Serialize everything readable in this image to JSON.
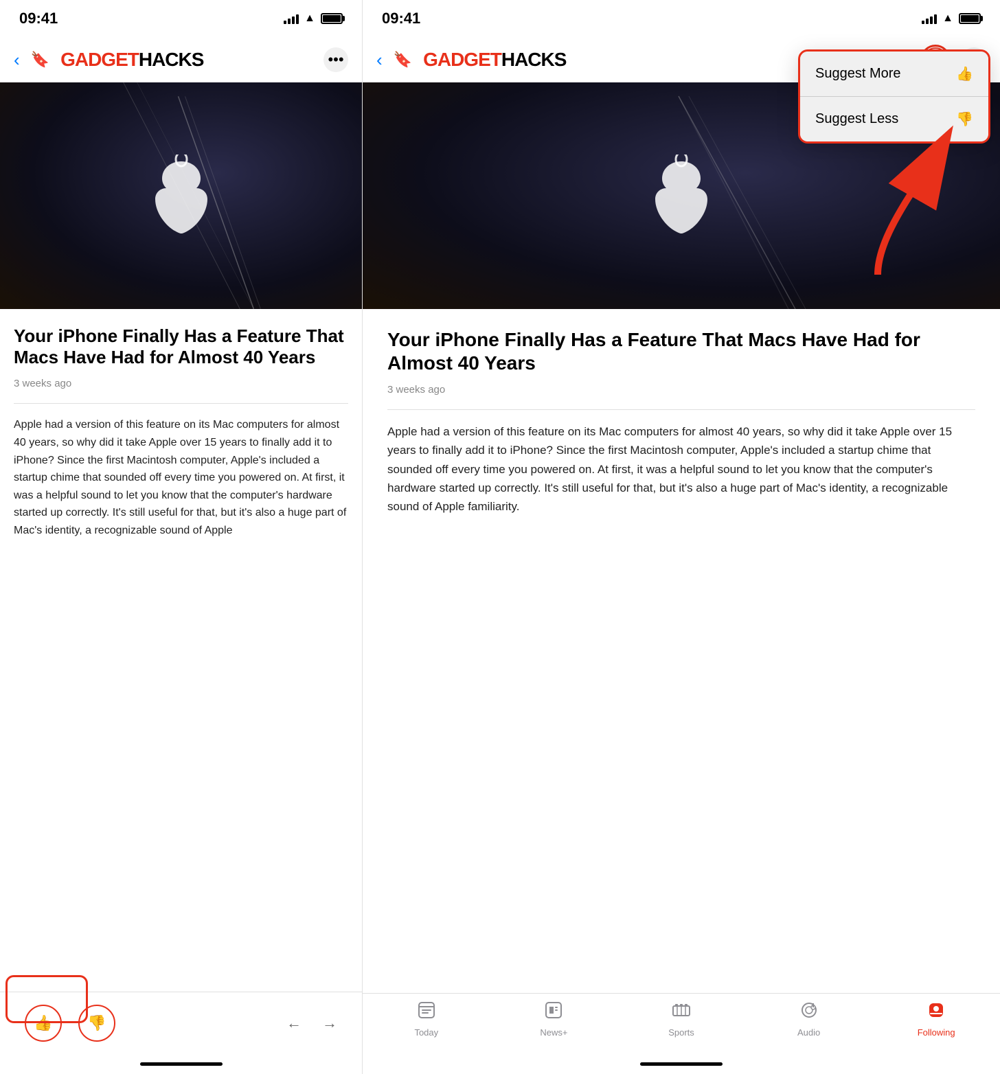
{
  "left_phone": {
    "status": {
      "time": "09:41"
    },
    "nav": {
      "back_label": "‹",
      "bookmark_label": "⊓",
      "logo_gadget": "GADGET",
      "logo_hacks": "HACKS",
      "more_label": "•••"
    },
    "article": {
      "title": "Your iPhone Finally Has a Feature That Macs Have Had for Almost 40 Years",
      "date": "3 weeks ago",
      "body": "Apple had a version of this feature on its Mac computers for almost 40 years, so why did it take Apple over 15 years to finally add it to iPhone? Since the first Macintosh computer, Apple's included a startup chime that sounded off every time you powered on. At first, it was a helpful sound to let you know that the computer's hardware started up correctly. It's still useful for that, but it's also a huge part of Mac's identity, a recognizable sound of Apple"
    },
    "bottom_bar": {
      "thumbup_label": "👍",
      "thumbdown_label": "👎",
      "back_arrow": "←",
      "forward_arrow": "→"
    }
  },
  "right_phone": {
    "status": {
      "time": "09:41"
    },
    "nav": {
      "back_label": "‹",
      "bookmark_label": "⊓",
      "logo_gadget": "GADGET",
      "logo_hacks": "HACKS",
      "thumb_label": "👍",
      "more_label": "•••"
    },
    "dropdown": {
      "suggest_more": "Suggest More",
      "suggest_more_icon": "👍",
      "suggest_less": "Suggest Less",
      "suggest_less_icon": "👎"
    },
    "article": {
      "title": "Your iPhone Finally Has a Feature That Macs Have Had for Almost 40 Years",
      "date": "3 weeks ago",
      "body": "Apple had a version of this feature on its Mac computers for almost 40 years, so why did it take Apple over 15 years to finally add it to iPhone? Since the first Macintosh computer, Apple's included a startup chime that sounded off every time you powered on. At first, it was a helpful sound to let you know that the computer's hardware started up correctly. It's still useful for that, but it's also a huge part of Mac's identity, a recognizable sound of Apple familiarity."
    },
    "tab_bar": {
      "items": [
        {
          "label": "Today",
          "icon": "📰",
          "active": false
        },
        {
          "label": "News+",
          "icon": "📄",
          "active": false
        },
        {
          "label": "Sports",
          "icon": "🏆",
          "active": false
        },
        {
          "label": "Audio",
          "icon": "🎧",
          "active": false
        },
        {
          "label": "Following",
          "icon": "🔍",
          "active": true
        }
      ]
    }
  }
}
